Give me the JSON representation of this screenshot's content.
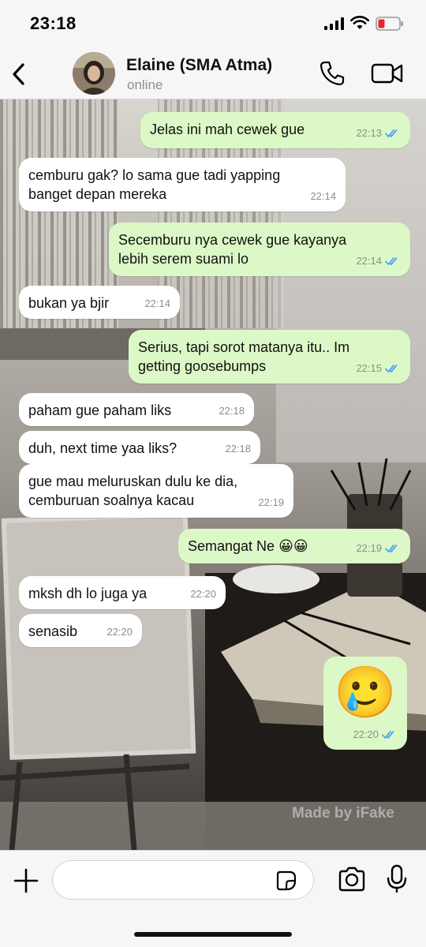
{
  "status_bar": {
    "time": "23:18"
  },
  "header": {
    "contact_name": "Elaine (SMA Atma)",
    "contact_status": "online",
    "icons": [
      "back-chevron-icon",
      "phone-icon",
      "video-camera-icon"
    ]
  },
  "messages": [
    {
      "dir": "out",
      "text": "Jelas ini mah cewek gue",
      "time": "22:13",
      "read": true
    },
    {
      "dir": "in",
      "text": "cemburu gak? lo sama gue tadi yapping\nbanget depan mereka",
      "time": "22:14"
    },
    {
      "dir": "out",
      "text": "Secemburu nya cewek gue kayanya\nlebih serem suami lo",
      "time": "22:14",
      "read": true
    },
    {
      "dir": "in",
      "text": "bukan ya bjir",
      "time": "22:14"
    },
    {
      "dir": "out",
      "text": "Serius, tapi sorot matanya itu.. Im\ngetting goosebumps",
      "time": "22:15",
      "read": true
    },
    {
      "dir": "in",
      "text": "paham gue paham liks",
      "time": "22:18"
    },
    {
      "dir": "in",
      "text": "duh, next time yaa liks?",
      "time": "22:18"
    },
    {
      "dir": "in",
      "text": "gue mau meluruskan dulu ke dia,\ncemburuan soalnya kacau",
      "time": "22:19"
    },
    {
      "dir": "out",
      "text": "Semangat Ne 😀😀",
      "time": "22:19",
      "read": true
    },
    {
      "dir": "in",
      "text": "mksh dh lo juga ya",
      "time": "22:20"
    },
    {
      "dir": "in",
      "text": "senasib",
      "time": "22:20"
    },
    {
      "dir": "out",
      "text": "🥲",
      "time": "22:20",
      "read": true,
      "emoji_only": true
    }
  ],
  "watermark": "Made by iFake",
  "input_bar": {
    "placeholder": "",
    "icons": [
      "plus-icon",
      "sticker-icon",
      "camera-icon",
      "microphone-icon"
    ]
  },
  "colors": {
    "outgoing_bubble": "#dcf8c6",
    "incoming_bubble": "#ffffff",
    "read_ticks": "#4fa3f7",
    "accent": "#007aff"
  }
}
